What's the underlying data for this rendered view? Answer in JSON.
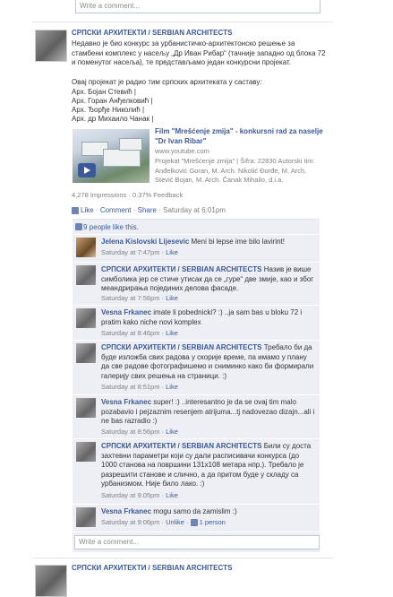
{
  "top_comment_placeholder": "Write a comment...",
  "post": {
    "author": "СРПСКИ АРХИТЕКТИ / SERBIAN ARCHITECTS",
    "paragraph1": "Недавно је био конкурс за урбанистичко-архитектонско решење за стамбени комплекс у насељу „Др Иван Рибар“ (тачније западно од блока 72 и поменутог насеља), те представљамо један конкурсни пројекат.",
    "paragraph2": "Овај пројекат је радио тим српских архитеката у саставу:",
    "team": [
      "Арх. Бојан Стевић |",
      "Арх. Горан Анђелковић |",
      "Арх. Ђорђе Николић |",
      "Арх. др Михаило Чанак |"
    ],
    "link": {
      "title": "Film \"Mrešćenje zmija\" - konkursni rad za naselje \"Dr Ivan Ribar\"",
      "domain": "www.youtube.com",
      "description": "Projekat \"Mrešćenje zmija\" | Šifra: 22830 Autorski tim: Anđelković Goran, M. Arch. Nikolić Đorđe, M. Arch. Stević Bojan, M. Arch. Čanak Mihailo, d.i.a."
    },
    "impressions": "4,278 Impressions · 0.37% Feedback",
    "actions": {
      "like": "Like",
      "comment": "Comment",
      "share": "Share",
      "time": "Saturday at 6:01pm"
    },
    "likes_text": "9 people like this."
  },
  "comments": [
    {
      "author": "Jelena Kislovski Lijesevic",
      "text": "Meni bi lepse ime bilo lavirint!",
      "time": "Saturday at 7:47pm",
      "like": "Like"
    },
    {
      "author": "СРПСКИ АРХИТЕКТИ / SERBIAN ARCHITECTS",
      "text": "Назив је више симболика јер се стиче утисак да се „гуре“ две змије, као и због меандрирања појединих делова фасаде.",
      "time": "Saturday at 7:56pm",
      "like": "Like"
    },
    {
      "author": "Vesna Frkanec",
      "text": "imate li pobednicki? :) ..ja sam bas u bloku 72 i pratim kako niche novi komplex",
      "time": "Saturday at 8:46pm",
      "like": "Like"
    },
    {
      "author": "СРПСКИ АРХИТЕКТИ / SERBIAN ARCHITECTS",
      "text": "Требало би да буде изложба свих радова у скорије време, па имамо у плану да све радове фотографишемо и сниминко како би формирали галерију свих решења на страници. :)",
      "time": "Saturday at 8:51pm",
      "like": "Like"
    },
    {
      "author": "Vesna Frkanec",
      "text": "super! :) ..interesantno je da se ovaj tim malo pozabavio i pejzaznim resenjem atrijuma...tj nadovezao dizajn...ali i ne bas razradio :)",
      "time": "Saturday at 8:56pm",
      "like": "Like"
    },
    {
      "author": "СРПСКИ АРХИТЕКТИ / SERBIAN ARCHITECTS",
      "text": "Били су доста захтевни параметри који су дали расписивачи конкурса (до 1000 станова на површини 131x108 метара нпр.). Требало је разрешити станове и слично, а да притом буде у складу са урбанизмом. Није било лако. :)",
      "time": "Saturday at 9:05pm",
      "like": "Like"
    },
    {
      "author": "Vesna Frkanec",
      "text": "mogu samo da zamislim :)",
      "time": "Saturday at 9:06pm",
      "like": "Unlike",
      "likes": "1 person"
    }
  ],
  "write_comment_placeholder": "Write a comment...",
  "next_post_author": "СРПСКИ АРХИТЕКТИ / SERBIAN ARCHITECTS"
}
